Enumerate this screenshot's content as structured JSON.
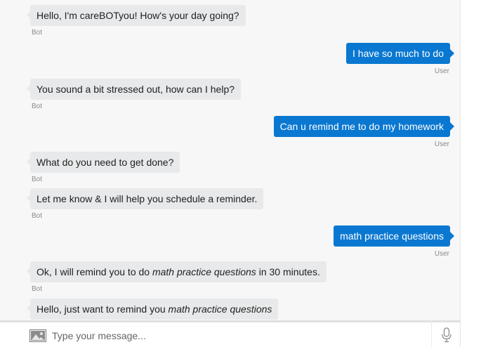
{
  "composer": {
    "placeholder": "Type your message...",
    "image_icon": "image-icon",
    "mic_icon": "microphone-icon"
  },
  "colors": {
    "bot_bubble": "#e8e9ea",
    "user_bubble": "#0a78d1",
    "background": "#f7f7f7"
  },
  "messages": [
    {
      "sender": "Bot",
      "text": "Hello, I'm careBOTyou! How's your day going?"
    },
    {
      "sender": "User",
      "text": "I have so much to do"
    },
    {
      "sender": "Bot",
      "text": "You sound a bit stressed out, how can I help?"
    },
    {
      "sender": "User",
      "text": "Can u remind me to do my homework"
    },
    {
      "sender": "Bot",
      "text": "What do you need to get done?"
    },
    {
      "sender": "Bot",
      "text": "Let me know & I will help you schedule a reminder."
    },
    {
      "sender": "User",
      "text": "math practice questions"
    },
    {
      "sender": "Bot",
      "text_before": "Ok, I will remind you to do ",
      "text_em": "math practice questions",
      "text_after": " in 30 minutes."
    },
    {
      "sender": "Bot",
      "text_before": "Hello, just want to remind you ",
      "text_em": "math practice questions"
    }
  ]
}
